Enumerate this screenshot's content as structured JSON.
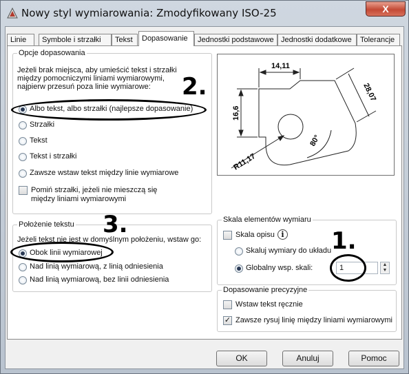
{
  "window": {
    "title": "Nowy styl wymiarowania: Zmodyfikowany ISO-25",
    "close_glyph": "X"
  },
  "tabs": [
    {
      "label": "Linie"
    },
    {
      "label": "Symbole i strzałki"
    },
    {
      "label": "Tekst"
    },
    {
      "label": "Dopasowanie",
      "active": true
    },
    {
      "label": "Jednostki podstawowe"
    },
    {
      "label": "Jednostki dodatkowe"
    },
    {
      "label": "Tolerancje"
    }
  ],
  "fit_options": {
    "legend": "Opcje dopasowania",
    "description": [
      "Jeżeli brak miejsca, aby umieścić tekst i strzałki",
      "między pomocniczymi liniami wymiarowymi,",
      "najpierw przesuń poza linie wymiarowe:"
    ],
    "options": [
      {
        "label": "Albo tekst, albo strzałki (najlepsze dopasowanie)",
        "selected": true
      },
      {
        "label": "Strzałki",
        "selected": false
      },
      {
        "label": "Tekst",
        "selected": false
      },
      {
        "label": "Tekst i strzałki",
        "selected": false
      },
      {
        "label": "Zawsze wstaw tekst między linie wymiarowe",
        "selected": false
      }
    ],
    "suppress_arrows": {
      "label": [
        "Pomiń strzałki, jeżeli nie mieszczą się",
        "między liniami wymiarowymi"
      ],
      "checked": false
    }
  },
  "text_placement": {
    "legend": "Położenie tekstu",
    "description": "Jeżeli tekst nie jest w domyślnym położeniu, wstaw go:",
    "options": [
      {
        "label": "Obok linii wymiarowej",
        "selected": true
      },
      {
        "label": "Nad linią wymiarową, z linią odniesienia",
        "selected": false
      },
      {
        "label": "Nad linią wymiarową, bez linii odniesienia",
        "selected": false
      }
    ]
  },
  "scale": {
    "legend": "Skala elementów wymiaru",
    "annotative": {
      "label": "Skala opisu",
      "checked": false,
      "info_glyph": "i"
    },
    "options": [
      {
        "label": "Skaluj wymiary do układu",
        "selected": false
      },
      {
        "label": "Globalny wsp. skali:",
        "selected": true
      }
    ],
    "global_value": "1"
  },
  "fine_tuning": {
    "legend": "Dopasowanie precyzyjne",
    "manual": {
      "label": "Wstaw tekst ręcznie",
      "checked": false
    },
    "always_draw": {
      "label": "Zawsze rysuj linię między liniami wymiarowymi",
      "checked": true,
      "check_glyph": "✓"
    }
  },
  "preview": {
    "labels": {
      "top": "14,11",
      "left": "16,6",
      "right": "28,07",
      "angle": "80°",
      "radius": "R11,17"
    }
  },
  "annotations": {
    "one": "1.",
    "two": "2.",
    "three": "3."
  },
  "buttons": {
    "ok": "OK",
    "cancel": "Anuluj",
    "help": "Pomoc"
  }
}
